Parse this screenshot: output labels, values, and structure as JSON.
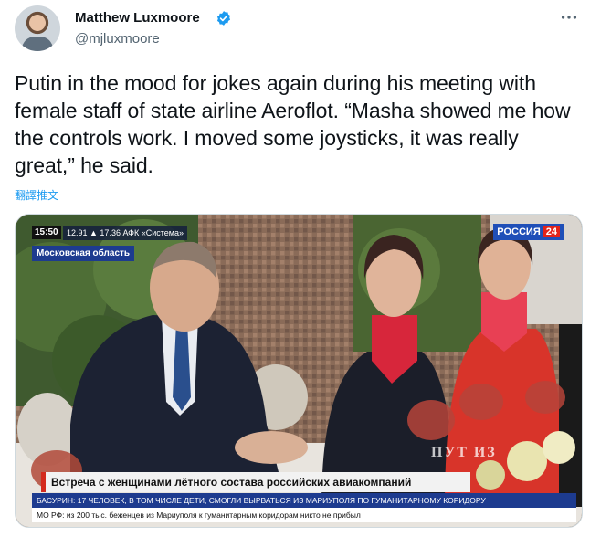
{
  "tweet": {
    "author_name": "Matthew Luxmoore",
    "handle": "@mjluxmoore",
    "text": "Putin in the mood for jokes again during his meeting with female staff of state airline Aeroflot. “Masha showed me how the controls work. I moved some joysticks, it was really great,” he said.",
    "translate_label": "翻譯推文",
    "verified_color": "#1d9bf0",
    "link_color": "#1d9bf0"
  },
  "media": {
    "time": "15:50",
    "market": "12.91 ▲ 17.36  АФК «Система»",
    "region": "Московская область",
    "channel": "РОССИЯ",
    "channel_number": "24",
    "headline": "Встреча с женщинами лётного состава российских авиакомпаний",
    "crawl_top": "БАСУРИН: 17 ЧЕЛОВЕК, В ТОМ ЧИСЛЕ ДЕТИ, СМОГЛИ ВЫРВАТЬСЯ ИЗ МАРИУПОЛЯ ПО ГУМАНИТАРНОМУ КОРИДОРУ",
    "crawl_bottom": "МО РФ: из 200 тыс. беженцев из Мариуполя к гуманитарным коридорам никто не прибыл",
    "watermark": "ПУТ ИЗ"
  }
}
